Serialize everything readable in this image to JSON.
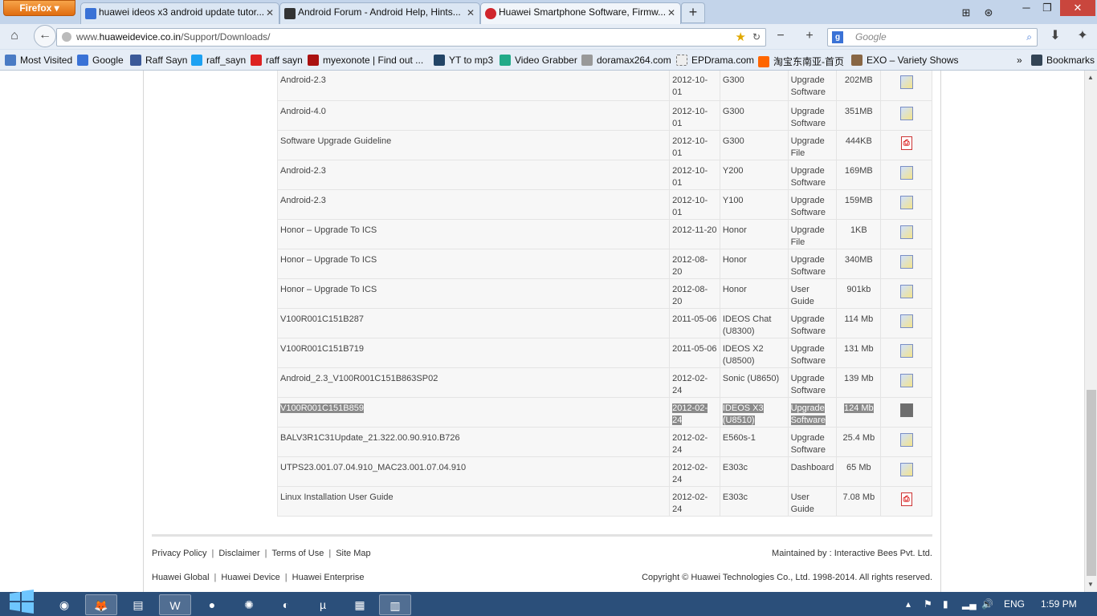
{
  "browser": {
    "menu_button": "Firefox",
    "tabs": [
      {
        "title": "huawei ideos x3 android update tutor...",
        "active": false
      },
      {
        "title": "Android Forum - Android Help, Hints...",
        "active": false
      },
      {
        "title": "Huawei Smartphone Software, Firmw...",
        "active": true
      }
    ],
    "url_prefix": "www.",
    "url_domain": "huaweidevice.co.in",
    "url_path": "/Support/Downloads/",
    "search_placeholder": "Google",
    "bookmarks": [
      "Most Visited",
      "Google",
      "Raff Sayn",
      "raff_sayn",
      "raff sayn",
      "myexonote | Find out ...",
      "YT to mp3",
      "Video Grabber",
      "doramax264.com",
      "EPDrama.com",
      "淘宝东南亚-首页",
      "EXO – Variety Shows"
    ],
    "bookmarks_menu": "Bookmarks"
  },
  "downloads": {
    "rows": [
      {
        "name": "Android-2.3",
        "date": "2012-10-01",
        "model": "G300",
        "type": "Upgrade Software",
        "size": "202MB",
        "icon": "download-icon",
        "selected": false
      },
      {
        "name": "Android-4.0",
        "date": "2012-10-01",
        "model": "G300",
        "type": "Upgrade Software",
        "size": "351MB",
        "icon": "download-icon",
        "selected": false
      },
      {
        "name": "Software Upgrade Guideline",
        "date": "2012-10-01",
        "model": "G300",
        "type": "Upgrade File",
        "size": "444KB",
        "icon": "pdf-icon",
        "selected": false
      },
      {
        "name": "Android-2.3",
        "date": "2012-10-01",
        "model": "Y200",
        "type": "Upgrade Software",
        "size": "169MB",
        "icon": "download-icon",
        "selected": false
      },
      {
        "name": "Android-2.3",
        "date": "2012-10-01",
        "model": "Y100",
        "type": "Upgrade Software",
        "size": "159MB",
        "icon": "download-icon",
        "selected": false
      },
      {
        "name": "Honor – Upgrade To ICS",
        "date": "2012-11-20",
        "model": "Honor",
        "type": "Upgrade File",
        "size": "1KB",
        "icon": "download-icon",
        "selected": false
      },
      {
        "name": "Honor – Upgrade To ICS",
        "date": "2012-08-20",
        "model": "Honor",
        "type": "Upgrade Software",
        "size": "340MB",
        "icon": "download-icon",
        "selected": false
      },
      {
        "name": "Honor – Upgrade To ICS",
        "date": "2012-08-20",
        "model": "Honor",
        "type": "User Guide",
        "size": "901kb",
        "icon": "download-icon",
        "selected": false
      },
      {
        "name": "V100R001C151B287",
        "date": "2011-05-06",
        "model": "IDEOS Chat (U8300)",
        "type": "Upgrade Software",
        "size": "114 Mb",
        "icon": "download-icon",
        "selected": false
      },
      {
        "name": "V100R001C151B719",
        "date": "2011-05-06",
        "model": "IDEOS X2 (U8500)",
        "type": "Upgrade Software",
        "size": "131 Mb",
        "icon": "download-icon",
        "selected": false
      },
      {
        "name": "Android_2.3_V100R001C151B863SP02",
        "date": "2012-02-24",
        "model": "Sonic (U8650)",
        "type": "Upgrade Software",
        "size": "139 Mb",
        "icon": "download-icon",
        "selected": false
      },
      {
        "name": "V100R001C151B859",
        "date": "2012-02-24",
        "model": "IDEOS X3 (U8510)",
        "type": "Upgrade Software",
        "size": "124 Mb",
        "icon": "download-icon",
        "selected": true
      },
      {
        "name": "BALV3R1C31Update_21.322.00.90.910.B726",
        "date": "2012-02-24",
        "model": "E560s-1",
        "type": "Upgrade Software",
        "size": "25.4 Mb",
        "icon": "download-icon",
        "selected": false
      },
      {
        "name": "UTPS23.001.07.04.910_MAC23.001.07.04.910",
        "date": "2012-02-24",
        "model": "E303c",
        "type": "Dashboard",
        "size": "65 Mb",
        "icon": "download-icon",
        "selected": false
      },
      {
        "name": "Linux Installation User Guide",
        "date": "2012-02-24",
        "model": "E303c",
        "type": "User Guide",
        "size": "7.08 Mb",
        "icon": "pdf-icon",
        "selected": false
      }
    ]
  },
  "footer": {
    "links1": [
      "Privacy Policy",
      "Disclaimer",
      "Terms of Use",
      "Site Map"
    ],
    "links2": [
      "Huawei Global",
      "Huawei Device",
      "Huawei Enterprise"
    ],
    "maintained": "Maintained by : Interactive Bees Pvt. Ltd.",
    "copyright": "Copyright © Huawei Technologies Co., Ltd. 1998-2014. All rights reserved."
  },
  "taskbar": {
    "language": "ENG",
    "time": "1:59 PM"
  }
}
